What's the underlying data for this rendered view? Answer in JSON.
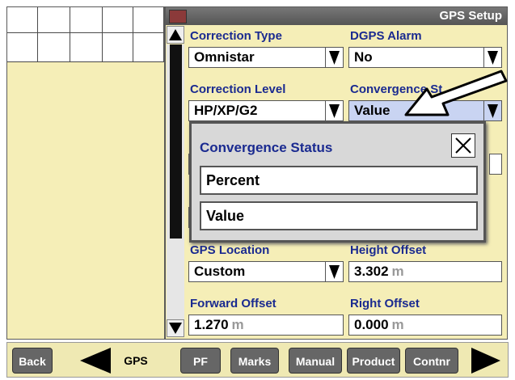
{
  "window": {
    "title": "GPS Setup"
  },
  "fields": {
    "correction_type": {
      "label": "Correction Type",
      "value": "Omnistar"
    },
    "dgps_alarm": {
      "label": "DGPS Alarm",
      "value": "No"
    },
    "correction_level": {
      "label": "Correction Level",
      "value": "HP/XP/G2"
    },
    "convergence_status": {
      "label": "Convergence St",
      "value": "Value"
    },
    "gps_location": {
      "label": "GPS Location",
      "value": "Custom"
    },
    "height_offset": {
      "label": "Height Offset",
      "value": "3.302",
      "unit": "m"
    },
    "forward_offset": {
      "label": "Forward Offset",
      "value": "1.270",
      "unit": "m"
    },
    "right_offset": {
      "label": "Right Offset",
      "value": "0.000",
      "unit": "m"
    }
  },
  "popup": {
    "title": "Convergence Status",
    "options": [
      "Percent",
      "Value"
    ]
  },
  "bottom_bar": {
    "back": "Back",
    "gps": "GPS",
    "pf": "PF",
    "marks": "Marks",
    "manual": "Manual",
    "product": "Product",
    "contnr": "Contnr"
  }
}
